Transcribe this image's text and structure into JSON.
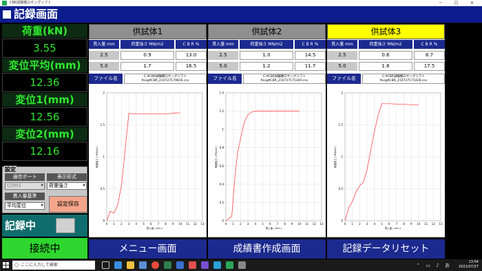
{
  "window": {
    "title": "CBR試験機ロギングソフト",
    "controls": "─ ☐ ✕"
  },
  "app": {
    "title": "記録画面"
  },
  "side": {
    "load_label": "荷重(kN)",
    "load_value": "3.55",
    "disp_avg_label": "変位平均(mm)",
    "disp_avg_value": "12.36",
    "disp1_label": "変位1(mm)",
    "disp1_value": "12.56",
    "disp2_label": "変位2(mm)",
    "disp2_value": "12.16"
  },
  "settings": {
    "group_label": "設定",
    "port_label": "通信ポート",
    "port_value": "COM3",
    "format_label": "表示形式",
    "format_value": "荷重強さ",
    "pen_label": "貫入量基準",
    "pen_value": "平均変位",
    "save_label": "設定保存"
  },
  "recording": {
    "label": "記録中"
  },
  "connection": {
    "label": "接続中"
  },
  "table_headers": {
    "pen": "貫入量 mm",
    "strength": "荷重強さ MN/m2",
    "cbr": "C B R %"
  },
  "file_label": "ファイル名",
  "specimens": [
    {
      "title": "供試体1",
      "active": false,
      "rows": [
        {
          "pen": "2.5",
          "strength": "0.9",
          "cbr": "13.0"
        },
        {
          "pen": "5.0",
          "strength": "1.7",
          "cbr": "16.5"
        }
      ],
      "file_line1": "C:¥CBR試験機ロギングソフト",
      "file_line2": "¥Log¥CBR_210727170816.csv"
    },
    {
      "title": "供試体2",
      "active": false,
      "rows": [
        {
          "pen": "2.5",
          "strength": "1.0",
          "cbr": "14.5"
        },
        {
          "pen": "5.0",
          "strength": "1.2",
          "cbr": "11.7"
        }
      ],
      "file_line1": "C:¥CBR試験機ロギングソフト",
      "file_line2": "¥Log¥CBR_210727171304.csv"
    },
    {
      "title": "供試体3",
      "active": true,
      "rows": [
        {
          "pen": "2.5",
          "strength": "0.6",
          "cbr": "8.7"
        },
        {
          "pen": "5.0",
          "strength": "1.8",
          "cbr": "17.5"
        }
      ],
      "file_line1": "C:¥CBR試験機ロギングソフト",
      "file_line2": "¥Log¥CBR_210727171428.csv"
    }
  ],
  "chart_data": [
    {
      "type": "line",
      "xlabel": "貫入量 ( mm )",
      "ylabel": "荷重強さ ( MN/m2 )",
      "xlim": [
        0,
        13
      ],
      "ylim": [
        0,
        2
      ],
      "xticks": [
        "0",
        "1",
        "2",
        "3",
        "4",
        "5",
        "6",
        "7",
        "8",
        "9",
        "10",
        "11",
        "12",
        "13"
      ],
      "yticks": [
        "0",
        "0.5",
        "1",
        "1.5",
        "2"
      ],
      "x": [
        0,
        0.5,
        1.0,
        1.5,
        2.0,
        2.5,
        3.0,
        4.0,
        6.0,
        8.0,
        10.0
      ],
      "y": [
        0,
        0.15,
        0.12,
        0.25,
        0.55,
        1.1,
        1.68,
        1.67,
        1.67,
        1.67,
        1.69
      ],
      "color": "#ff3030"
    },
    {
      "type": "line",
      "xlabel": "貫入量 ( mm )",
      "ylabel": "荷重強さ ( MN/m2 )",
      "xlim": [
        0,
        13
      ],
      "ylim": [
        0,
        1.4
      ],
      "xticks": [
        "0",
        "1",
        "2",
        "3",
        "4",
        "5",
        "6",
        "7",
        "8",
        "9",
        "10",
        "11",
        "12",
        "13"
      ],
      "yticks": [
        "0",
        "0.2",
        "0.4",
        "0.6",
        "0.8",
        "1",
        "1.2",
        "1.4"
      ],
      "x": [
        0,
        0.8,
        1.2,
        1.6,
        2.0,
        2.5,
        3.0,
        3.5,
        4.0,
        5.0,
        7.0,
        9.0,
        10.0
      ],
      "y": [
        0,
        0.05,
        0.45,
        0.75,
        0.9,
        1.08,
        1.16,
        1.19,
        1.2,
        1.2,
        1.2,
        1.2,
        1.2
      ],
      "color": "#ff3030"
    },
    {
      "type": "line",
      "xlabel": "貫入量 ( mm )",
      "ylabel": "荷重強さ ( MN/m2 )",
      "xlim": [
        0,
        13
      ],
      "ylim": [
        0,
        2
      ],
      "xticks": [
        "0",
        "1",
        "2",
        "3",
        "4",
        "5",
        "6",
        "7",
        "8",
        "9",
        "10",
        "11",
        "12",
        "13"
      ],
      "yticks": [
        "0",
        "0.5",
        "1",
        "1.5",
        "2"
      ],
      "x": [
        0,
        0.5,
        1.0,
        1.5,
        2.0,
        2.5,
        3.0,
        3.5,
        4.0,
        4.5,
        5.0,
        6.0,
        8.0,
        10.0
      ],
      "y": [
        0,
        0.2,
        0.3,
        0.45,
        0.55,
        0.6,
        0.8,
        1.1,
        1.4,
        1.65,
        1.83,
        1.83,
        1.82,
        1.81
      ],
      "color": "#ff3030"
    }
  ],
  "bottom_buttons": {
    "menu": "メニュー画面",
    "report": "成績書作成画面",
    "reset": "記録データリセット"
  },
  "taskbar": {
    "search_placeholder": "ここに入力して検索",
    "time": "13:54",
    "date": "2021/07/27"
  }
}
